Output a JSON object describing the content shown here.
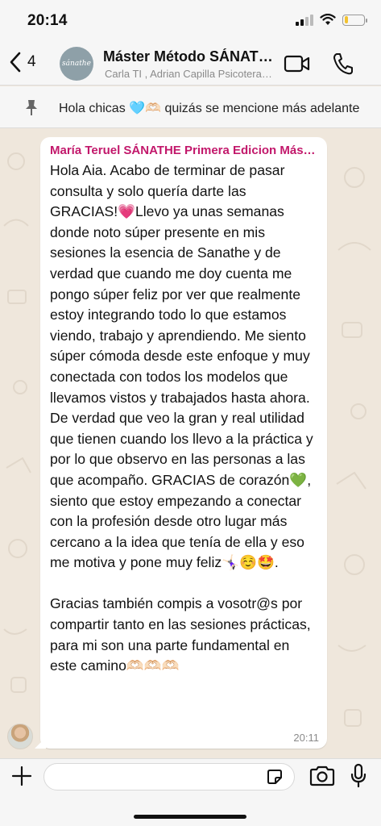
{
  "status_bar": {
    "time": "20:14",
    "battery_level": 0.2
  },
  "header": {
    "back_count": "4",
    "group_avatar_text": "sánathe",
    "title": "Máster Método SÁNATHE Primera Edicion",
    "subtitle": "Carla TI , Adrian Capilla Psicoterapeuta",
    "icons": {
      "back": "chevron-left-icon",
      "video": "video-camera-icon",
      "call": "phone-icon"
    }
  },
  "pinned": {
    "icon": "pin-icon",
    "text": "Hola chicas 🩵🫶🏻 quizás se mencione más adelante"
  },
  "message": {
    "sender": "María Teruel SÁNATHE Primera Edicion Máster",
    "text": "Hola Aia. Acabo de terminar de pasar consulta y solo quería darte las GRACIAS!💗Llevo ya unas semanas donde noto súper presente en mis sesiones la esencia de Sanathe y de verdad que cuando me doy cuenta me pongo súper feliz por ver que realmente estoy integrando todo lo que estamos viendo, trabajo y aprendiendo. Me siento súper cómoda desde este enfoque y muy conectada con todos los modelos que llevamos vistos y trabajados hasta ahora.  De verdad que veo la gran y real utilidad que tienen cuando los llevo a la práctica y por lo que observo en las personas a las que acompaño. GRACIAS de corazón💚, siento que estoy empezando a conectar con la profesión desde otro lugar más cercano a la idea que tenía de ella y eso me motiva y pone muy feliz🤸🏻‍♀️☺️🤩.\n\nGracias también compis a vosotr@s por compartir tanto en las sesiones prácticas, para mi son una parte fundamental en este camino🫶🏻🫶🏻🫶🏻",
    "time": "20:11"
  },
  "input_bar": {
    "placeholder": "",
    "icons": {
      "plus": "plus-icon",
      "sticker": "sticker-icon",
      "camera": "camera-icon",
      "mic": "microphone-icon"
    }
  },
  "colors": {
    "sender_name": "#c2186b",
    "wallpaper": "#efe7dc",
    "bar_background": "#f6f6f6"
  }
}
